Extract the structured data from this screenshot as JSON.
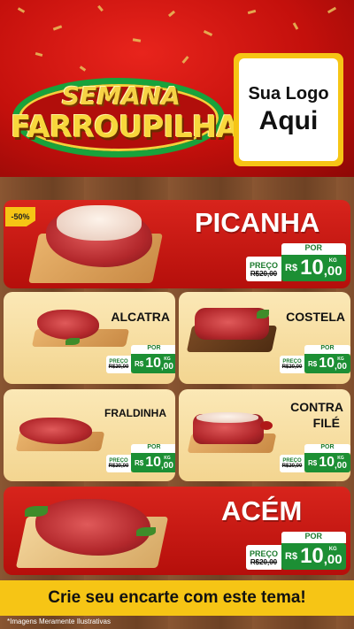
{
  "header": {
    "campaign_top": "SEMANA",
    "campaign_bottom": "FARROUPILHA",
    "logo_line1": "Sua Logo",
    "logo_line2": "Aqui"
  },
  "products": {
    "picanha": {
      "name": "PICANHA",
      "discount_badge": "-50%",
      "price_label": "PREÇO",
      "old_price": "R$20,00",
      "por_label": "POR",
      "currency": "R$",
      "price_int": "10",
      "price_cents": ",00",
      "unit": "KG"
    },
    "alcatra": {
      "name": "ALCATRA",
      "price_label": "PREÇO",
      "old_price": "R$20,00",
      "por_label": "POR",
      "currency": "R$",
      "price_int": "10",
      "price_cents": ",00",
      "unit": "KG"
    },
    "costela": {
      "name": "COSTELA",
      "price_label": "PREÇO",
      "old_price": "R$20,00",
      "por_label": "POR",
      "currency": "R$",
      "price_int": "10",
      "price_cents": ",00",
      "unit": "KG"
    },
    "fraldinha": {
      "name": "FRALDINHA",
      "price_label": "PREÇO",
      "old_price": "R$20,00",
      "por_label": "POR",
      "currency": "R$",
      "price_int": "10",
      "price_cents": ",00",
      "unit": "KG"
    },
    "contrafile": {
      "name_line1": "CONTRA",
      "name_line2": "FILÉ",
      "price_label": "PREÇO",
      "old_price": "R$20,00",
      "por_label": "POR",
      "currency": "R$",
      "price_int": "10",
      "price_cents": ",00",
      "unit": "KG"
    },
    "acem": {
      "name": "ACÉM",
      "price_label": "PREÇO",
      "old_price": "R$20,00",
      "por_label": "POR",
      "currency": "R$",
      "price_int": "10",
      "price_cents": ",00",
      "unit": "KG"
    }
  },
  "footer": {
    "cta": "Crie seu encarte com este tema!",
    "note": "*Imagens Meramente Ilustrativas"
  },
  "colors": {
    "red": "#c4100c",
    "yellow": "#f6c515",
    "green": "#1c8f34",
    "cream": "#fbe8b6"
  }
}
